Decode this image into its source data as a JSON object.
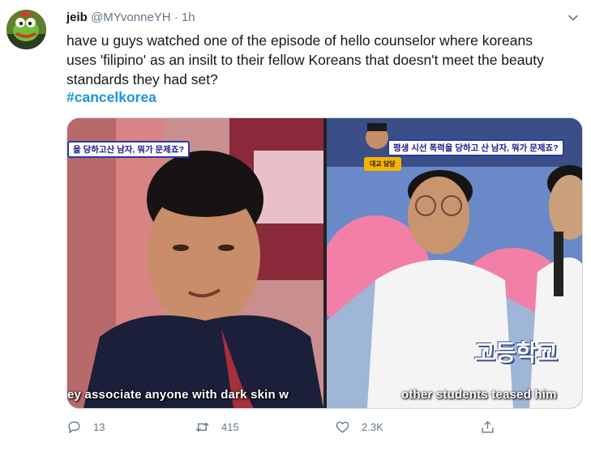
{
  "tweet": {
    "author_name": "jeib",
    "author_handle": "@MYvonneYH",
    "separator": "·",
    "time": "1h",
    "text_lines": [
      "have u guys watched one of the episode of hello counselor where koreans",
      "uses 'filipino' as an insilt to their fellow Koreans that doesn't meet the beauty",
      "standards they had set?"
    ],
    "hashtag": "#cancelkorea"
  },
  "media": {
    "left_banner": "을 당하고산 남자, 뭐가 문제죠?",
    "left_subtitle": "ey associate anyone with dark skin w",
    "right_banner": "평생 시선 폭력을 당하고 산 남자, 뭐가 문제죠?",
    "right_badge": "대교 담당",
    "right_big_caption": "고등학교",
    "right_subtitle": "other students teased him"
  },
  "actions": {
    "reply_count": "13",
    "retweet_count": "415",
    "like_count": "2.3K"
  },
  "colors": {
    "accent": "#1b95e0",
    "muted": "#657786",
    "text": "#14171a"
  }
}
